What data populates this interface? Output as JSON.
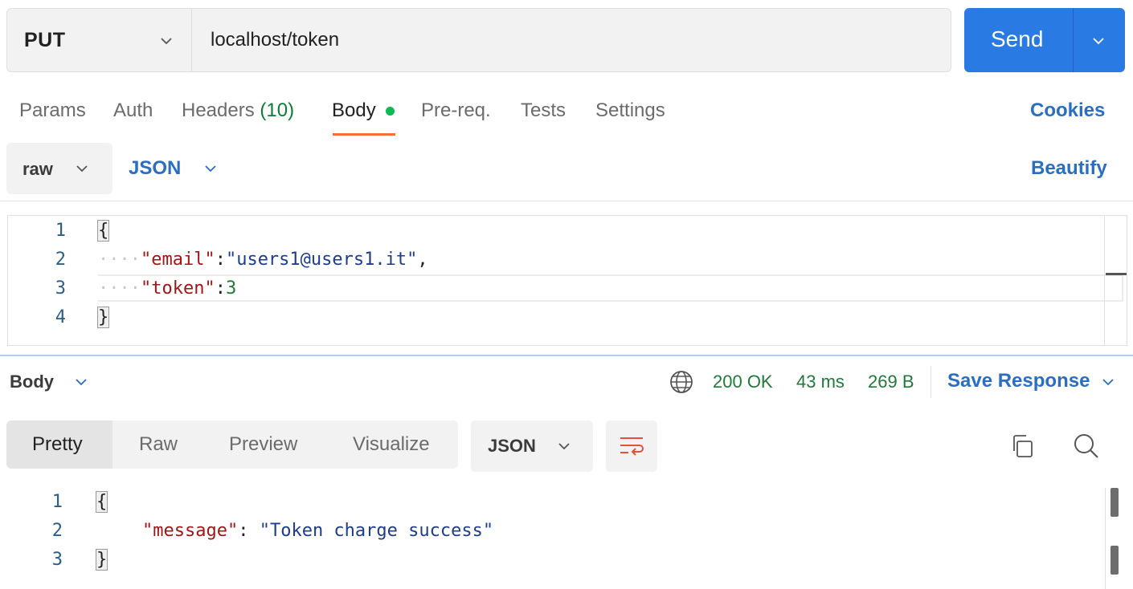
{
  "request": {
    "method": "PUT",
    "url": "localhost/token",
    "send_label": "Send"
  },
  "tabs": [
    {
      "label": "Params"
    },
    {
      "label": "Auth"
    },
    {
      "label": "Headers",
      "count": "(10)"
    },
    {
      "label": "Body",
      "active": true,
      "has_content": true
    },
    {
      "label": "Pre-req."
    },
    {
      "label": "Tests"
    },
    {
      "label": "Settings"
    }
  ],
  "cookies_label": "Cookies",
  "body_format": {
    "mode": "raw",
    "language": "JSON",
    "beautify_label": "Beautify"
  },
  "request_body": {
    "line_numbers": [
      "1",
      "2",
      "3",
      "4"
    ],
    "lines": {
      "l1": "{",
      "l2_ws": "····",
      "l2_key": "\"email\"",
      "l2_colon": ":",
      "l2_val": "\"users1@users1.it\"",
      "l2_comma": ",",
      "l3_ws": "····",
      "l3_key": "\"token\"",
      "l3_colon": ":",
      "l3_val": "3",
      "l4": "}"
    }
  },
  "response": {
    "section_label": "Body",
    "status": "200 OK",
    "time": "43 ms",
    "size": "269 B",
    "save_label": "Save Response",
    "view_modes": [
      "Pretty",
      "Raw",
      "Preview",
      "Visualize"
    ],
    "active_view": "Pretty",
    "language": "JSON",
    "line_numbers": [
      "1",
      "2",
      "3"
    ],
    "lines": {
      "l1": "{",
      "l2_key": "\"message\"",
      "l2_colon": ": ",
      "l2_val": "\"Token charge success\"",
      "l3": "}"
    }
  },
  "colors": {
    "accent": "#2a7ae4",
    "tab_underline": "#ff6c37",
    "status_green": "#1f7a3a",
    "json_key": "#a31515",
    "json_string": "#1c3c8c"
  }
}
